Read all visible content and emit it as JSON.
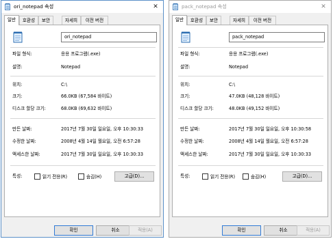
{
  "colors": {
    "accent_border": "#2f7ad6",
    "window_border_active": "#5a8fc8",
    "window_border_inactive": "#a9a9a9"
  },
  "icons": {
    "app": "notepad-icon",
    "file": "notepad-file-icon",
    "close": "close-icon"
  },
  "windows": [
    {
      "title": "ori_notepad 속성",
      "close": "✕",
      "tabs": [
        "일반",
        "호환성",
        "보안",
        "자세히",
        "이전 버전"
      ],
      "active_tab": "일반",
      "filename": "ori_notepad",
      "rows": {
        "file_type": {
          "label": "파일 형식:",
          "value": "응용 프로그램(.exe)"
        },
        "description": {
          "label": "설명:",
          "value": "Notepad"
        },
        "location": {
          "label": "위치:",
          "value": "C:\\"
        },
        "size": {
          "label": "크기:",
          "value": "66.0KB (67,584 바이트)"
        },
        "size_on_disk": {
          "label": "디스크 할당 크기:",
          "value": "68.0KB (69,632 바이트)"
        },
        "created": {
          "label": "만든 날짜:",
          "value": "2017년 7월 30일 일요일, 오후 10:30:33"
        },
        "modified": {
          "label": "수정한 날짜:",
          "value": "2008년 4월 14일 월요일, 오전 6:57:28"
        },
        "accessed": {
          "label": "액세스한 날짜:",
          "value": "2017년 7월 30일 일요일, 오후 10:30:33"
        }
      },
      "attributes": {
        "label": "특성:",
        "readonly": "읽기 전용(R)",
        "hidden": "숨김(H)",
        "advanced": "고급(D)..."
      },
      "buttons": {
        "ok": "확인",
        "cancel": "취소",
        "apply": "적용(A)"
      }
    },
    {
      "title": "pack_notepad 속성",
      "close": "✕",
      "tabs": [
        "일반",
        "호환성",
        "보안",
        "자세히",
        "이전 버전"
      ],
      "active_tab": "일반",
      "filename": "pack_notepad",
      "rows": {
        "file_type": {
          "label": "파일 형식:",
          "value": "응용 프로그램(.exe)"
        },
        "description": {
          "label": "설명:",
          "value": "Notepad"
        },
        "location": {
          "label": "위치:",
          "value": "C:\\"
        },
        "size": {
          "label": "크기:",
          "value": "47.0KB (48,128 바이트)"
        },
        "size_on_disk": {
          "label": "디스크 할당 크기:",
          "value": "48.0KB (49,152 바이트)"
        },
        "created": {
          "label": "만든 날짜:",
          "value": "2017년 7월 30일 일요일, 오후 10:30:58"
        },
        "modified": {
          "label": "수정한 날짜:",
          "value": "2008년 4월 14일 월요일, 오전 6:57:28"
        },
        "accessed": {
          "label": "액세스한 날짜:",
          "value": "2017년 7월 30일 일요일, 오후 10:30:33"
        }
      },
      "attributes": {
        "label": "특성:",
        "readonly": "읽기 전용(R)",
        "hidden": "숨김(H)",
        "advanced": "고급(D)..."
      },
      "buttons": {
        "ok": "확인",
        "cancel": "취소",
        "apply": "적용(A)"
      }
    }
  ]
}
